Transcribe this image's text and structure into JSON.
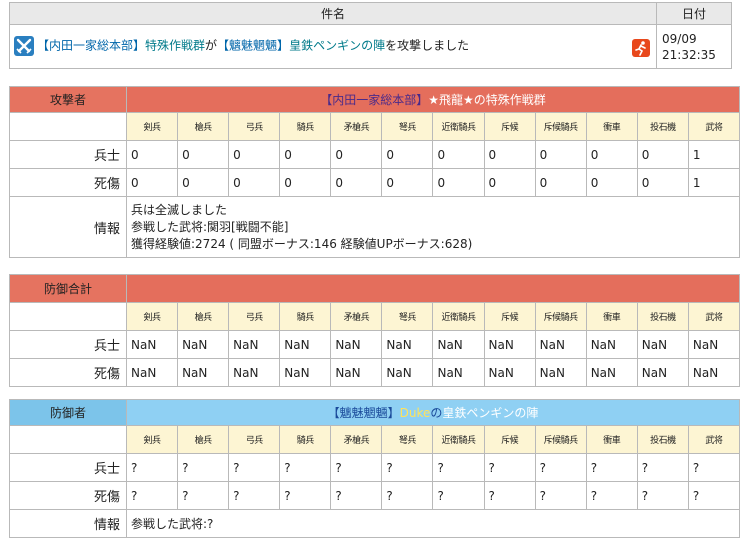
{
  "header": {
    "subject_label": "件名",
    "date_label": "日付",
    "message": {
      "attacker_bracket": "【内田一家総本部】",
      "attacker_unit": "特殊作戦群",
      "connector1": "が",
      "defender_bracket": "【魑魅魍魎】",
      "defender_unit": "皇鉄ペンギンの陣",
      "connector2": "を攻撃しました"
    },
    "date": "09/09",
    "time": "21:32:35"
  },
  "unit_headers": [
    "剣兵",
    "槍兵",
    "弓兵",
    "騎兵",
    "矛槍兵",
    "弩兵",
    "近衛騎兵",
    "斥候",
    "斥候騎兵",
    "衝車",
    "投石機",
    "武将"
  ],
  "attacker": {
    "label": "攻撃者",
    "title": {
      "alliance": "【内田一家総本部】",
      "name": "★飛龍★",
      "no": "の",
      "unit": "特殊作戦群"
    },
    "soldiers_label": "兵士",
    "casualties_label": "死傷",
    "soldiers": [
      "0",
      "0",
      "0",
      "0",
      "0",
      "0",
      "0",
      "0",
      "0",
      "0",
      "0",
      "1"
    ],
    "casualties": [
      "0",
      "0",
      "0",
      "0",
      "0",
      "0",
      "0",
      "0",
      "0",
      "0",
      "0",
      "1"
    ],
    "info_label": "情報",
    "info_lines": [
      "兵は全滅しました",
      "参戦した武将:関羽[戦闘不能]",
      "獲得経験値:2724 ( 同盟ボーナス:146 経験値UPボーナス:628)"
    ]
  },
  "defense_total": {
    "label": "防御合計",
    "soldiers_label": "兵士",
    "casualties_label": "死傷",
    "soldiers": [
      "NaN",
      "NaN",
      "NaN",
      "NaN",
      "NaN",
      "NaN",
      "NaN",
      "NaN",
      "NaN",
      "NaN",
      "NaN",
      "NaN"
    ],
    "casualties": [
      "NaN",
      "NaN",
      "NaN",
      "NaN",
      "NaN",
      "NaN",
      "NaN",
      "NaN",
      "NaN",
      "NaN",
      "NaN",
      "NaN"
    ]
  },
  "defender": {
    "label": "防御者",
    "title": {
      "alliance": "【魑魅魍魎】",
      "name": "Duke",
      "no": "の",
      "unit": "皇鉄ペンギンの陣"
    },
    "soldiers_label": "兵士",
    "casualties_label": "死傷",
    "soldiers": [
      "?",
      "?",
      "?",
      "?",
      "?",
      "?",
      "?",
      "?",
      "?",
      "?",
      "?",
      "?"
    ],
    "casualties": [
      "?",
      "?",
      "?",
      "?",
      "?",
      "?",
      "?",
      "?",
      "?",
      "?",
      "?",
      "?"
    ],
    "info_label": "情報",
    "info_lines": [
      "参戦した武将:?"
    ]
  },
  "colors": {
    "attack_header": "#e46e5c",
    "defend_header": "#8fd0f3",
    "unit_header_bg": "#fdf5d3"
  },
  "icons": {
    "message": "crossed-swords-icon",
    "action": "runner-icon"
  }
}
